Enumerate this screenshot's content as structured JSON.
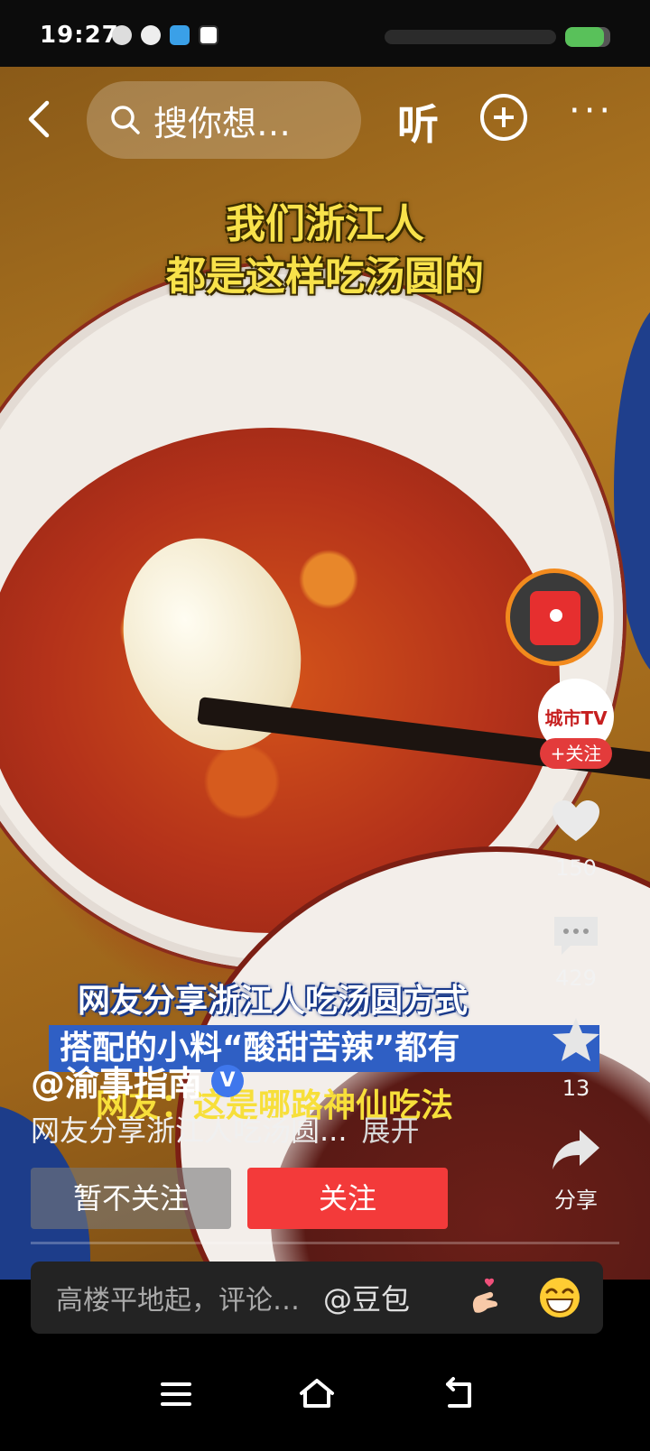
{
  "status_bar": {
    "time": "19:27",
    "battery_level": 0.85
  },
  "top_nav": {
    "search_placeholder": "搜你想…",
    "listen_label": "听",
    "more_label": "···"
  },
  "video": {
    "caption_top": [
      "我们浙江人",
      "都是这样吃汤圆的"
    ],
    "subtitles": [
      "网友分享浙江人吃汤圆方式",
      "搭配的小料“酸甜苦辣”都有",
      "网友：这是哪路神仙吃法"
    ]
  },
  "right_rail": {
    "account_logo_text": "城市TV",
    "follow_pill": "+关注",
    "like_count": "150",
    "comment_count": "429",
    "favorite_count": "13",
    "share_label": "分享"
  },
  "author": {
    "name": "@渝事指南",
    "verified_mark": "V"
  },
  "description": {
    "text": "网友分享浙江人吃汤圆...",
    "expand": "展开"
  },
  "buttons": {
    "unfollow": "暂不关注",
    "follow": "关注"
  },
  "comment_bar": {
    "placeholder": "高楼平地起，评论…",
    "mention": "@豆包"
  },
  "colors": {
    "accent_red": "#f33a3a",
    "subtitle_blue": "#2f5fc4",
    "caption_yellow": "#f8e24a"
  }
}
